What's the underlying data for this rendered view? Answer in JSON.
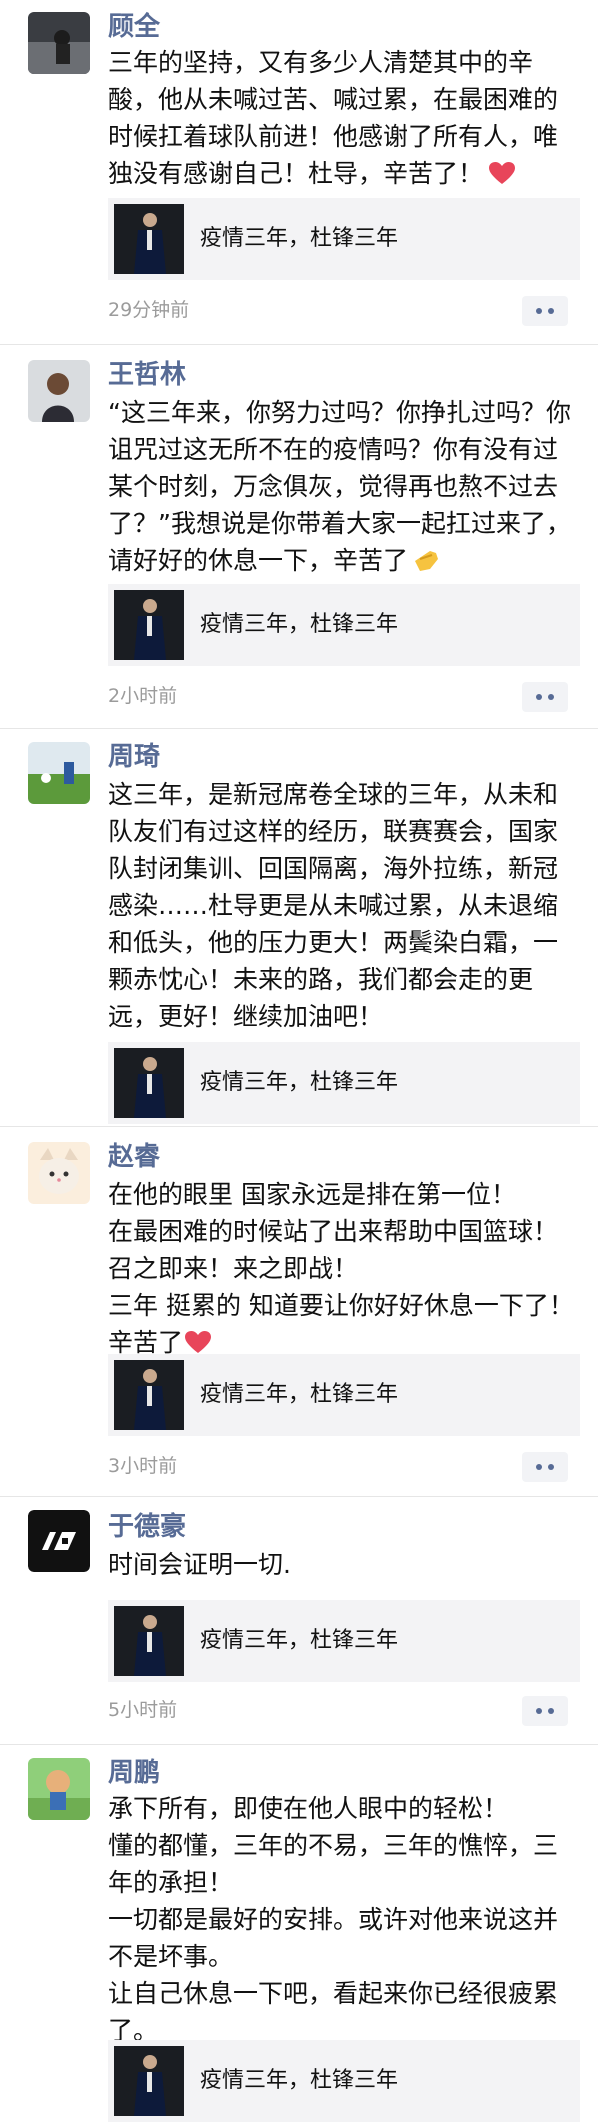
{
  "posts": [
    {
      "name": "顾全",
      "lines": [
        "三年的坚持，又有多少人清楚其中的辛",
        "酸，他从未喊过苦、喊过累，在最困难的",
        "时候扛着球队前进！他感谢了所有人，唯",
        "独没有感谢自己！杜导，辛苦了！"
      ],
      "time": "29分钟前",
      "end_emoji": "red-heart"
    },
    {
      "name": "王哲林",
      "lines": [
        "“这三年来，你努力过吗？你挣扎过吗？你",
        "诅咒过这无所不在的疫情吗？你有没有过",
        "某个时刻，万念俱灰，觉得再也熬不过去",
        "了？”我想说是你带着大家一起扛过来了，",
        "请好好的休息一下，辛苦了"
      ],
      "time": "2小时前",
      "end_emoji": "salute-hand"
    },
    {
      "name": "周琦",
      "lines": [
        "这三年，是新冠席卷全球的三年，从未和",
        "队友们有过这样的经历，联赛赛会，国家",
        "队封闭集训、回国隔离，海外拉练，新冠",
        "感染……杜导更是从未喊过累，从未退缩",
        "和低头，他的压力更大！两鬓染白霜，一",
        "颗赤忱心！未来的路，我们都会走的更",
        "远，更好！继续加油吧！"
      ]
    },
    {
      "name": "赵睿",
      "lines": [
        "在他的眼里 国家永远是排在第一位！",
        "在最困难的时候站了出来帮助中国篮球！",
        "召之即来！来之即战！",
        "三年 挺累的 知道要让你好好休息一下了！",
        "辛苦了"
      ],
      "time": "3小时前",
      "end_emoji": "red-heart"
    },
    {
      "name": "于德豪",
      "lines": [
        "时间会证明一切."
      ],
      "time": "5小时前"
    },
    {
      "name": "周鹏",
      "lines": [
        "承下所有，即使在他人眼中的轻松！",
        "懂的都懂，三年的不易，三年的憔悴，三",
        "年的承担！",
        "一切都是最好的安排。或许对他来说这并",
        "不是坏事。",
        "让自己休息一下吧，看起来你已经很疲累",
        "了。"
      ]
    }
  ],
  "card_title": "疫情三年，杜锋三年",
  "colors": {
    "name": "#576b95",
    "time": "#9b9b9b",
    "card_bg": "#f3f3f5"
  }
}
